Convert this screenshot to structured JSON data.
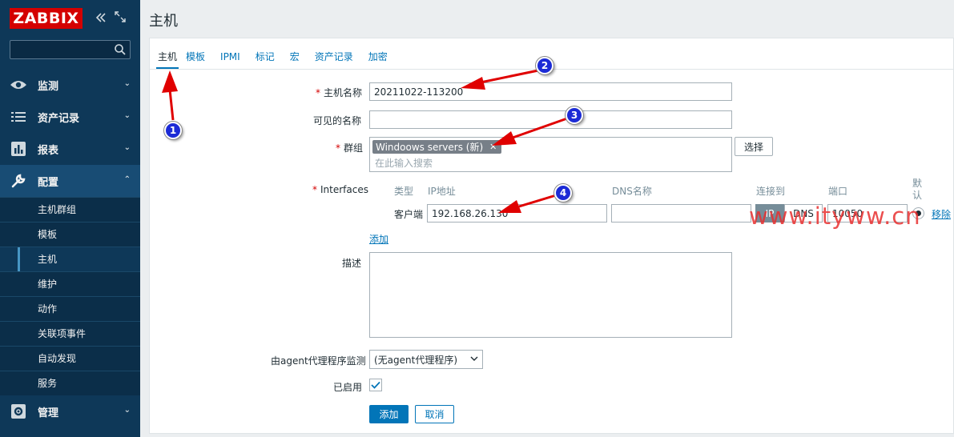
{
  "sidebar": {
    "logo": "ZABBIX",
    "search_placeholder": "",
    "menu": [
      {
        "label": "监测",
        "icon": "eye-icon"
      },
      {
        "label": "资产记录",
        "icon": "list-icon"
      },
      {
        "label": "报表",
        "icon": "bar-chart-icon"
      },
      {
        "label": "配置",
        "icon": "wrench-icon"
      },
      {
        "label": "管理",
        "icon": "gear-icon"
      }
    ],
    "submenu": [
      "主机群组",
      "模板",
      "主机",
      "维护",
      "动作",
      "关联项事件",
      "自动发现",
      "服务"
    ]
  },
  "page": {
    "title": "主机"
  },
  "tabs": [
    "主机",
    "模板",
    "IPMI",
    "标记",
    "宏",
    "资产记录",
    "加密"
  ],
  "form": {
    "host_name_label": "主机名称",
    "host_name_value": "20211022-113200",
    "visible_name_label": "可见的名称",
    "visible_name_value": "",
    "groups_label": "群组",
    "group_chip": "Windoows servers (新)",
    "group_placeholder": "在此输入搜索",
    "select_button": "选择",
    "interfaces_label": "Interfaces",
    "interfaces_columns": {
      "type": "类型",
      "ip": "IP地址",
      "dns": "DNS名称",
      "connect": "连接到",
      "port": "端口",
      "default": "默认"
    },
    "interface_row": {
      "type": "客户端",
      "ip": "192.168.26.130",
      "dns": "",
      "ip_btn": "IP",
      "dns_btn": "DNS",
      "port": "10050",
      "remove": "移除"
    },
    "add_link": "添加",
    "description_label": "描述",
    "description_value": "",
    "proxy_label": "由agent代理程序监测",
    "proxy_value": "(无agent代理程序)",
    "enabled_label": "已启用",
    "submit_button": "添加",
    "cancel_button": "取消"
  },
  "watermark": "www.ityww.cn",
  "annotations": [
    "1",
    "2",
    "3",
    "4"
  ],
  "colors": {
    "sidebar": "#0e3858",
    "accent": "#0275b8",
    "logo": "#d40000",
    "required": "#d40000",
    "chip": "#777f88",
    "annotation_marker": "#1c2bd6",
    "arrow": "#e00000"
  }
}
